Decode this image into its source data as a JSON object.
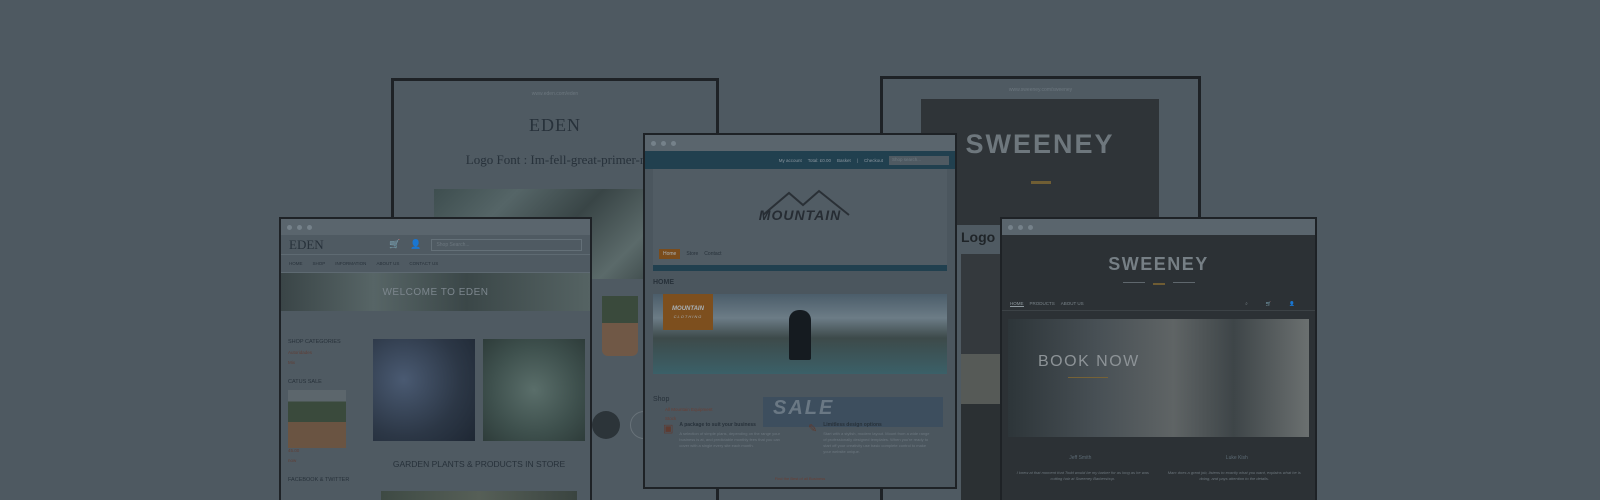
{
  "eden_back": {
    "url": "www.eden.com/eden",
    "logo": "EDEN",
    "font_label": "Logo Font : Im-fell-great-primer-r"
  },
  "sweeney_back": {
    "url": "www.sweeney.com/sweeney",
    "brand": "SWEENEY",
    "font_label": "Logo F"
  },
  "eden_front": {
    "logo": "EDEN",
    "search_placeholder": "Shop Search...",
    "nav": [
      "HOME",
      "SHOP",
      "INFORMATION",
      "ABOUT US",
      "CONTACT US"
    ],
    "banner": "WELCOME TO EDEN",
    "shop_categories_title": "SHOP CATEGORIES",
    "categories": [
      "Autoridades",
      "Mix"
    ],
    "sale_title": "CATUS SALE",
    "sale_items": [
      "45.00",
      "now"
    ],
    "social_title": "FACEBOOK & TWITTER",
    "caption": "GARDEN PLANTS & PRODUCTS IN STORE"
  },
  "mountain": {
    "topbar": [
      "My account",
      "Total: £0.00",
      "Basket",
      "|",
      "Checkout"
    ],
    "search_placeholder": "Shop search...",
    "logo": "MOUNTAIN",
    "menu": [
      "Home",
      "Store",
      "Contact"
    ],
    "home_label": "HOME",
    "badge_title": "MOUNTAIN",
    "badge_sub": "CLOTHING",
    "shop_title": "Shop",
    "shop_items": [
      "All Mountain Equipment",
      "Stock"
    ],
    "sale": "SALE",
    "features": [
      {
        "title": "A package to suit your business",
        "desc": "A selection of simple plans, depending on the range your business is at, and predictable monthly fees that you can cover with a single every site each month."
      },
      {
        "title": "Limitless design options",
        "desc": "Start with a stylish, modern layout. Mount from a wide range of professionally designed templates. When you're ready to start off your creativity use basic complete control to make your website unique."
      }
    ],
    "footer": "Find the Best of all Business"
  },
  "sweeney_front": {
    "brand": "SWEENEY",
    "nav": [
      "HOME",
      "PRODUCTS",
      "ABOUT US"
    ],
    "book": "BOOK NOW",
    "names": [
      "Jeff Smith",
      "Luke Kish"
    ],
    "quotes": [
      "I knew at that moment that Todd would be my barber for as long as he was cutting hair at Sweeney Barbershop.",
      "Marc does a great job, listens to exactly what you want, explains what he is doing, and pays attention to the details."
    ]
  },
  "colors": {
    "background": "#4e5961",
    "accent_brown": "#7a4c1c",
    "mountain_blue": "#21404f"
  }
}
